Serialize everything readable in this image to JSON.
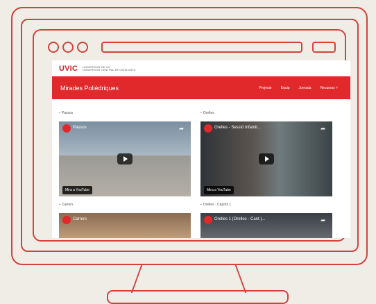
{
  "branding": {
    "logo": "UVIC",
    "logo_sub1": "UNIVERSITAT DE VIC",
    "logo_sub2": "UNIVERSITAT CENTRAL DE CATALUNYA"
  },
  "site": {
    "title": "Mirades Polièdriques"
  },
  "nav": [
    {
      "label": "Projecte"
    },
    {
      "label": "Equip"
    },
    {
      "label": "Jornada"
    },
    {
      "label": "Recursos ˅"
    }
  ],
  "videos": [
    {
      "label": "Passos",
      "title": "Passos",
      "yt": "Mira a  YouTube"
    },
    {
      "label": "Orelles",
      "title": "Orelles - Sessió Infantil...",
      "yt": "Mira a  YouTube"
    },
    {
      "label": "Carrers",
      "title": "Carrers",
      "yt": ""
    },
    {
      "label": "Orelles · Capítol 1",
      "title": "Orelles 1 (Orelles - Cant.)...",
      "yt": ""
    }
  ]
}
